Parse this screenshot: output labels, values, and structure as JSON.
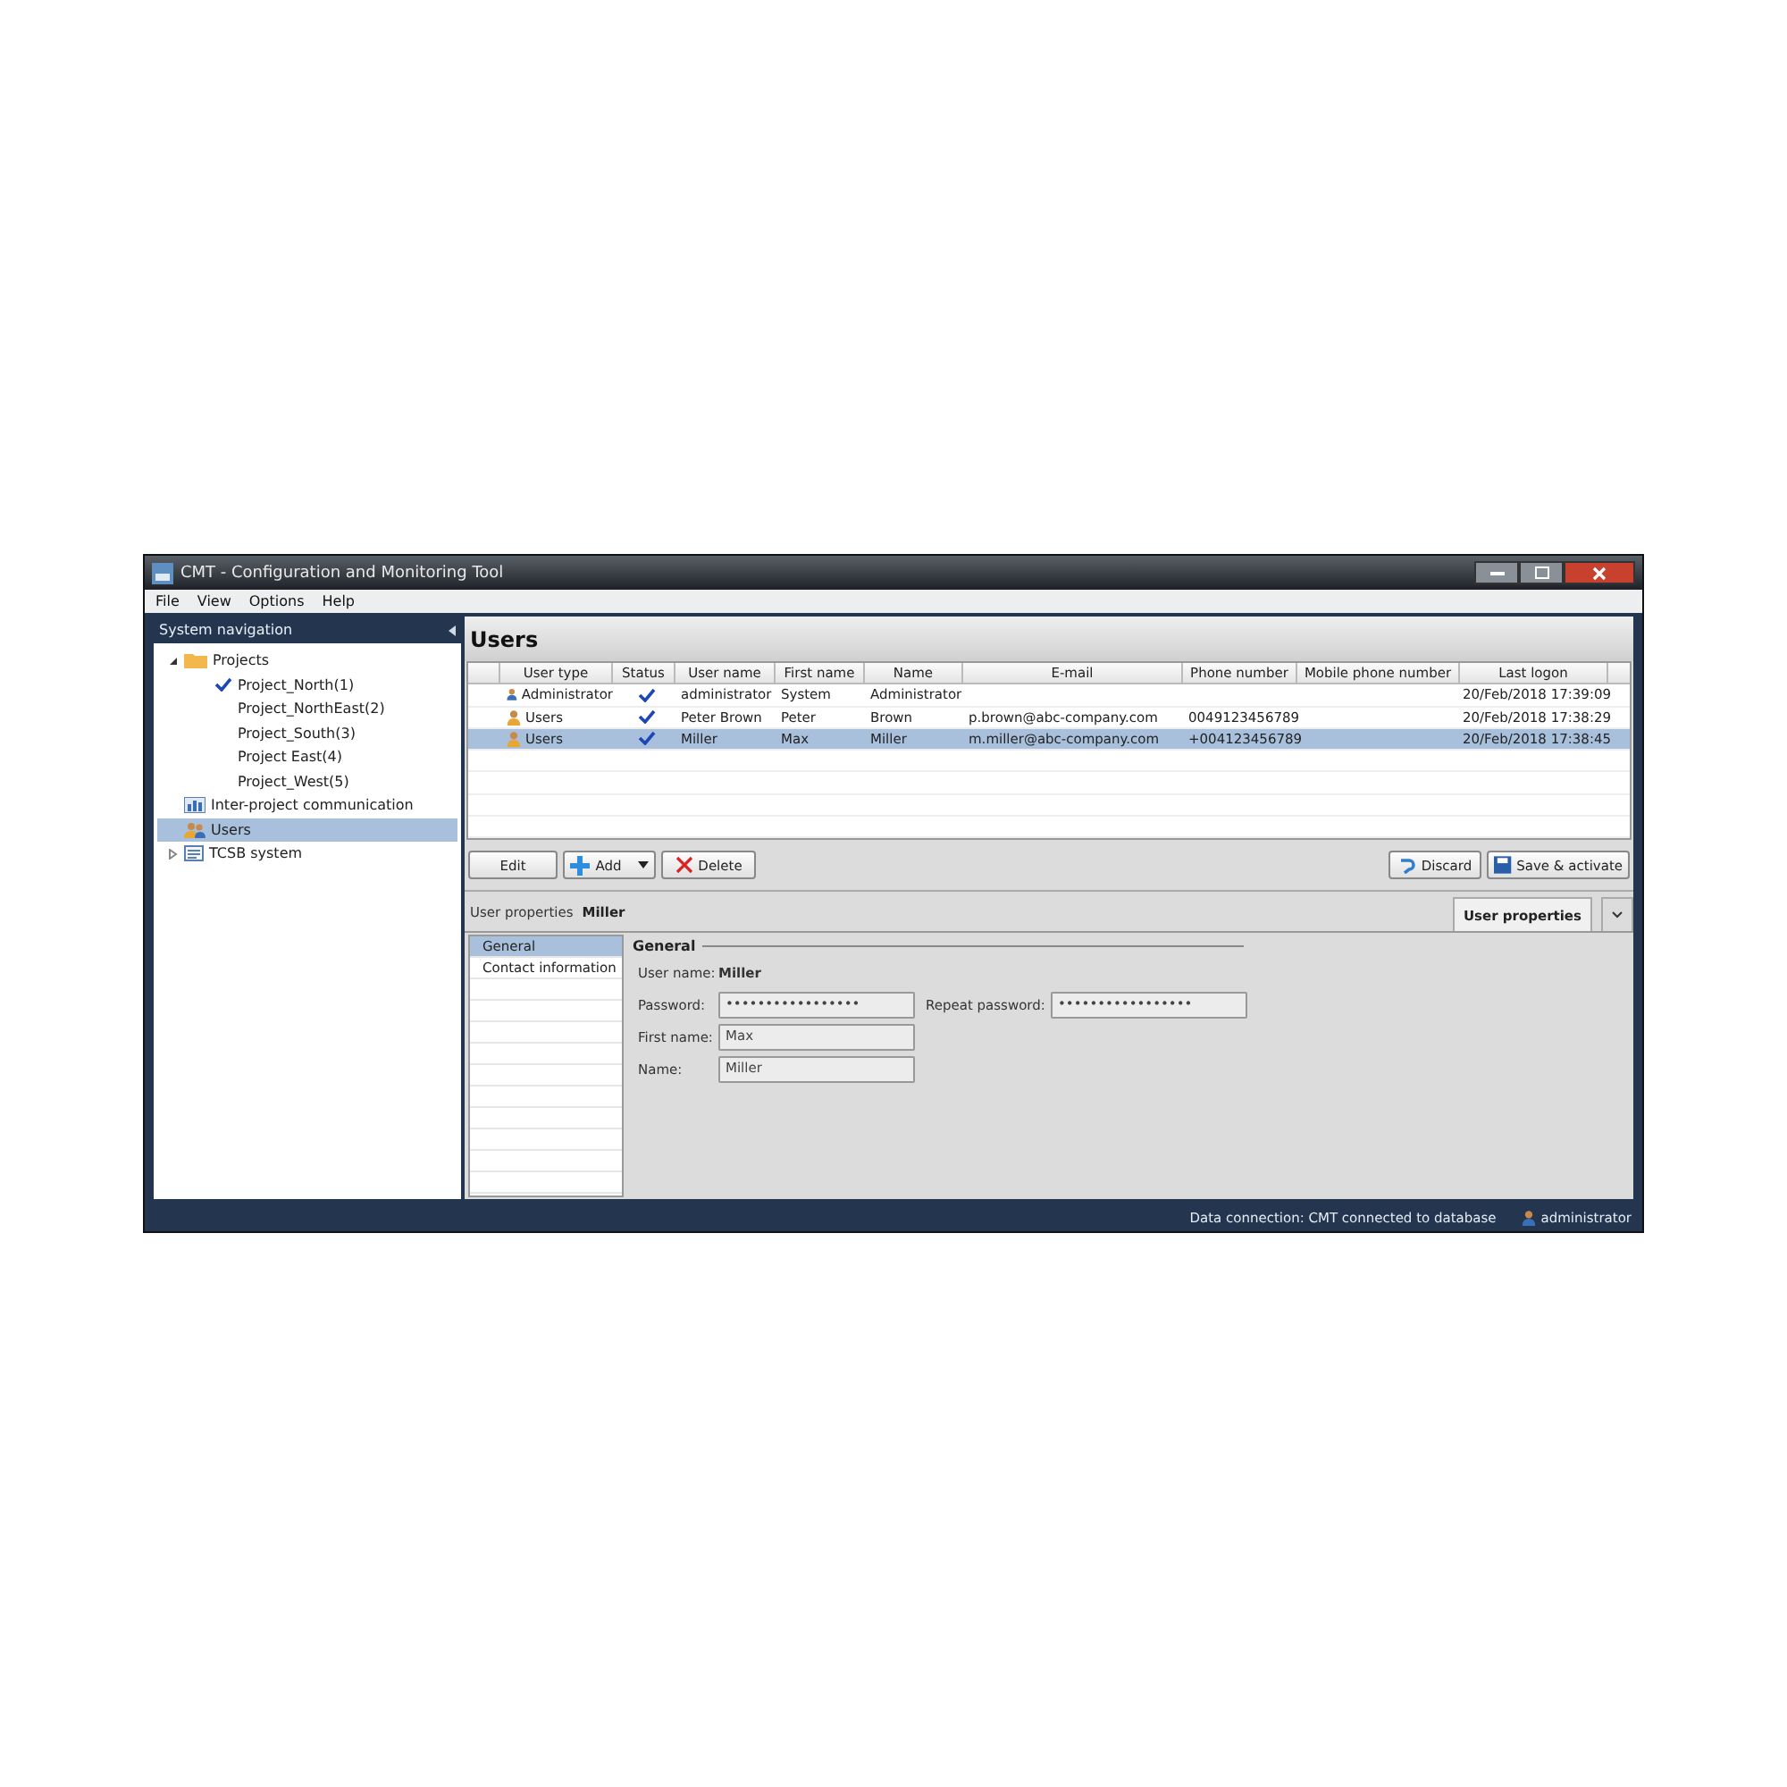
{
  "window": {
    "title": "CMT - Configuration and Monitoring Tool"
  },
  "menu": [
    "File",
    "View",
    "Options",
    "Help"
  ],
  "navigation": {
    "title": "System navigation",
    "tree": [
      {
        "label": "Projects",
        "kind": "folder",
        "expanded": true,
        "selected": false,
        "children": [
          {
            "label": "Project_North(1)",
            "checked": true,
            "selected": false
          },
          {
            "label": "Project_NorthEast(2)",
            "checked": false,
            "selected": false
          },
          {
            "label": "Project_South(3)",
            "checked": false,
            "selected": false
          },
          {
            "label": "Project East(4)",
            "checked": false,
            "selected": false
          },
          {
            "label": "Project_West(5)",
            "checked": false,
            "selected": false
          }
        ]
      },
      {
        "label": "Inter-project communication",
        "kind": "chart",
        "selected": false
      },
      {
        "label": "Users",
        "kind": "users",
        "selected": true
      },
      {
        "label": "TCSB system",
        "kind": "list",
        "expanded": false,
        "selected": false
      }
    ]
  },
  "users": {
    "title": "Users",
    "columns": [
      "User type",
      "Status",
      "User name",
      "First name",
      "Name",
      "E-mail",
      "Phone number",
      "Mobile phone number",
      "Last logon"
    ],
    "rows": [
      {
        "kind": "admin",
        "status": true,
        "cells": [
          "Administrator",
          "",
          "administrator",
          "System",
          "Administrator",
          "",
          "",
          "",
          "20/Feb/2018 17:39:09"
        ],
        "selected": false
      },
      {
        "kind": "user",
        "status": true,
        "cells": [
          "Users",
          "",
          "Peter Brown",
          "Peter",
          "Brown",
          "p.brown@abc-company.com",
          "0049123456789",
          "",
          "20/Feb/2018 17:38:29"
        ],
        "selected": false
      },
      {
        "kind": "user",
        "status": true,
        "cells": [
          "Users",
          "",
          "Miller",
          "Max",
          "Miller",
          "m.miller@abc-company.com",
          "+004123456789",
          "",
          "20/Feb/2018 17:38:45"
        ],
        "selected": true
      }
    ],
    "buttons": [
      {
        "label": "Edit",
        "kind": "plain"
      },
      {
        "label": "Add",
        "kind": "add"
      },
      {
        "label": "Delete",
        "kind": "delete"
      },
      {
        "label": "Discard",
        "kind": "discard"
      },
      {
        "label": "Save & activate",
        "kind": "save"
      }
    ]
  },
  "properties": {
    "label": "User properties",
    "name": "Miller",
    "tab": "User properties",
    "sections": [
      {
        "label": "General",
        "selected": true
      },
      {
        "label": "Contact information",
        "selected": false
      }
    ],
    "group": "General",
    "user_name_label": "User name:",
    "user_name": "Miller",
    "fields": [
      {
        "label": "Password:",
        "value": "•••••••••••••••••"
      },
      {
        "label": "Repeat password:",
        "value": "•••••••••••••••••"
      },
      {
        "label": "First name:",
        "value": "Max"
      },
      {
        "label": "Name:",
        "value": "Miller"
      }
    ]
  },
  "status_bar": {
    "connection": "Data connection: CMT connected to database",
    "user": "administrator"
  }
}
